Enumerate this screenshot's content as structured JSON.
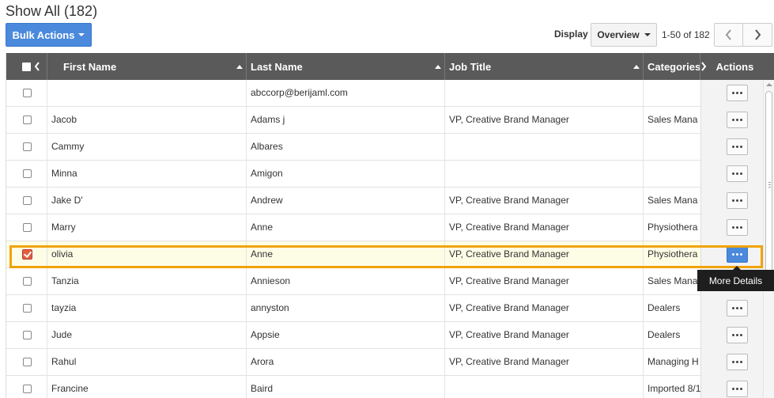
{
  "header": {
    "title": "Show All (182)",
    "bulk_actions_label": "Bulk Actions",
    "display_label": "Display",
    "display_value": "Overview",
    "pager_range": "1-50 of 182"
  },
  "table": {
    "columns": {
      "first_name": "First Name",
      "last_name": "Last Name",
      "job_title": "Job Title",
      "categories": "Categories",
      "actions": "Actions"
    },
    "rows": [
      {
        "first": "",
        "last": "abccorp@berijaml.com",
        "job": "",
        "category": "",
        "checked": false
      },
      {
        "first": "Jacob",
        "last": "Adams j",
        "job": "VP, Creative Brand Manager",
        "category": "Sales Mana",
        "checked": false
      },
      {
        "first": "Cammy",
        "last": "Albares",
        "job": "",
        "category": "",
        "checked": false
      },
      {
        "first": "Minna",
        "last": "Amigon",
        "job": "",
        "category": "",
        "checked": false
      },
      {
        "first": "Jake D'",
        "last": "Andrew",
        "job": "VP, Creative Brand Manager",
        "category": "Sales Mana",
        "checked": false
      },
      {
        "first": "Marry",
        "last": "Anne",
        "job": "VP, Creative Brand Manager",
        "category": "Physiothera",
        "checked": false
      },
      {
        "first": "olivia",
        "last": "Anne",
        "job": "VP, Creative Brand Manager",
        "category": "Physiothera",
        "checked": true
      },
      {
        "first": "Tanzia",
        "last": "Annieson",
        "job": "VP, Creative Brand Manager",
        "category": "Sales Mana",
        "checked": false
      },
      {
        "first": "tayzia",
        "last": "annyston",
        "job": "VP, Creative Brand Manager",
        "category": "Dealers",
        "checked": false
      },
      {
        "first": "Jude",
        "last": "Appsie",
        "job": "VP, Creative Brand Manager",
        "category": "Dealers",
        "checked": false
      },
      {
        "first": "Rahul",
        "last": "Arora",
        "job": "VP, Creative Brand Manager",
        "category": "Managing H",
        "checked": false
      },
      {
        "first": "Francine",
        "last": "Baird",
        "job": "",
        "category": "Imported 8/1",
        "checked": false
      }
    ]
  },
  "tooltip": "More Details",
  "colors": {
    "primary": "#4a89dc",
    "header_bg": "#5a5a5a",
    "highlight": "#f0a30a",
    "selected_row": "#fdfde6"
  }
}
